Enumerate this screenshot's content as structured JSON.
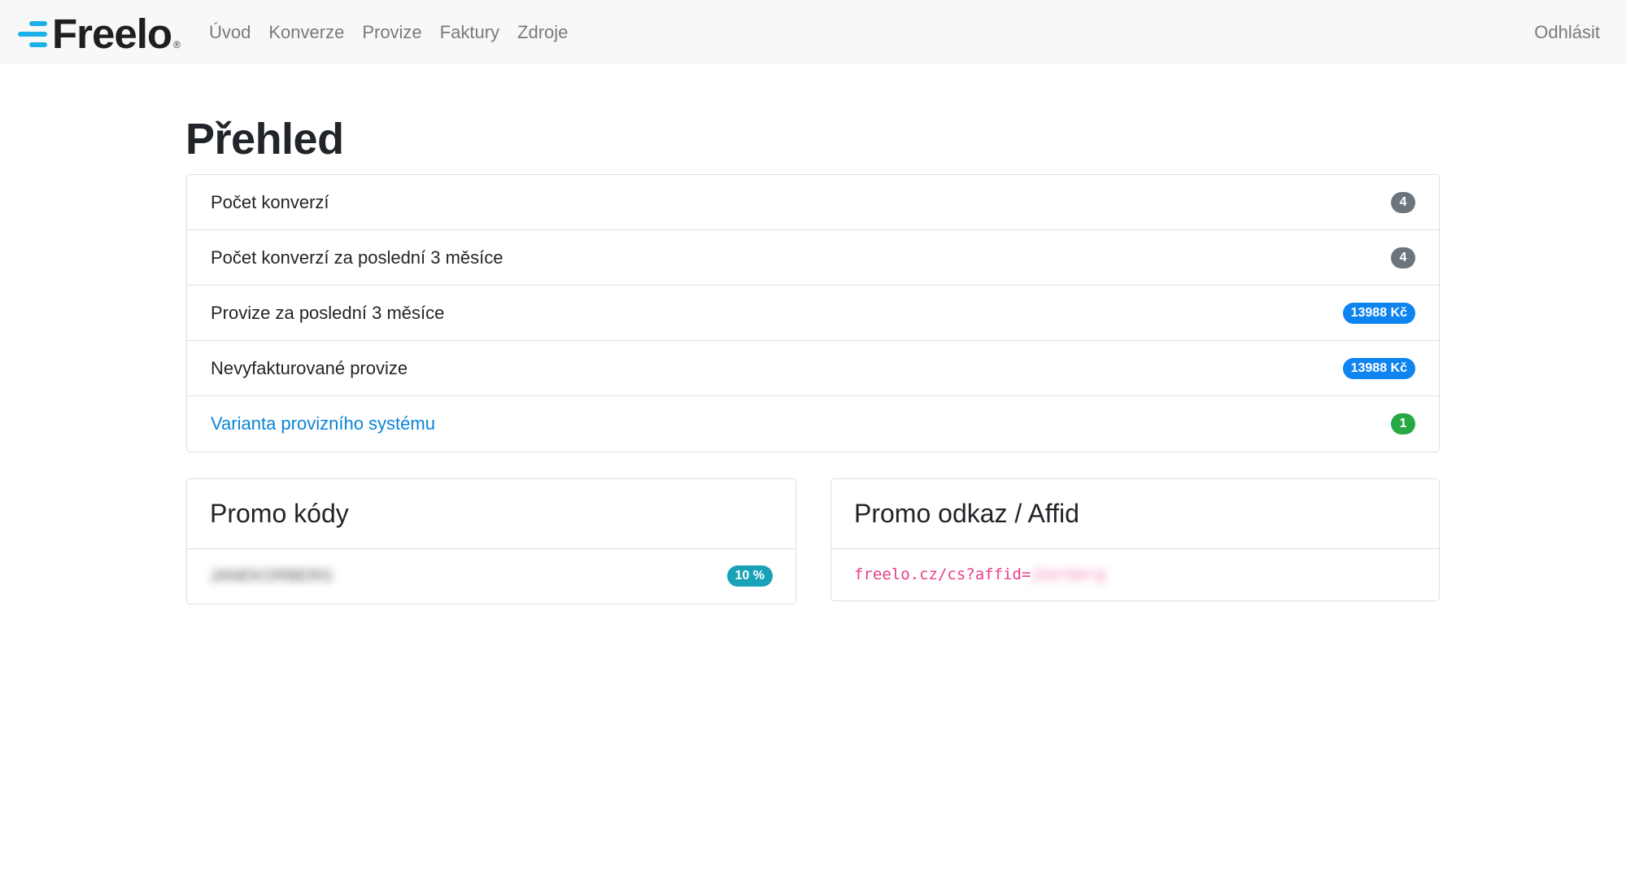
{
  "navbar": {
    "brand": "Freelo",
    "brand_reg": "®",
    "links": [
      "Úvod",
      "Konverze",
      "Provize",
      "Faktury",
      "Zdroje"
    ],
    "logout": "Odhlásit"
  },
  "page": {
    "title": "Přehled"
  },
  "stats": [
    {
      "label": "Počet konverzí",
      "value": "4"
    },
    {
      "label": "Počet konverzí za poslední 3 měsíce",
      "value": "4"
    },
    {
      "label": "Provize za poslední 3 měsíce",
      "value": "13988 Kč"
    },
    {
      "label": "Nevyfakturované provize",
      "value": "13988 Kč"
    },
    {
      "label": "Varianta provizního systému",
      "value": "1"
    }
  ],
  "promo_codes": {
    "title": "Promo kódy",
    "code": "JANEKORBERG",
    "discount": "10 %"
  },
  "promo_link": {
    "title": "Promo odkaz / Affid",
    "url_prefix": "freelo.cz/cs?affid=",
    "affid": "jkorberg"
  },
  "colors": {
    "accent": "#0a84d8",
    "badge_gray": "#6c757d",
    "badge_blue": "#0d84f0",
    "badge_green": "#28a745",
    "badge_teal": "#17a2b8",
    "code_pink": "#e83e8c",
    "logo_blue": "#1ab0e8"
  }
}
